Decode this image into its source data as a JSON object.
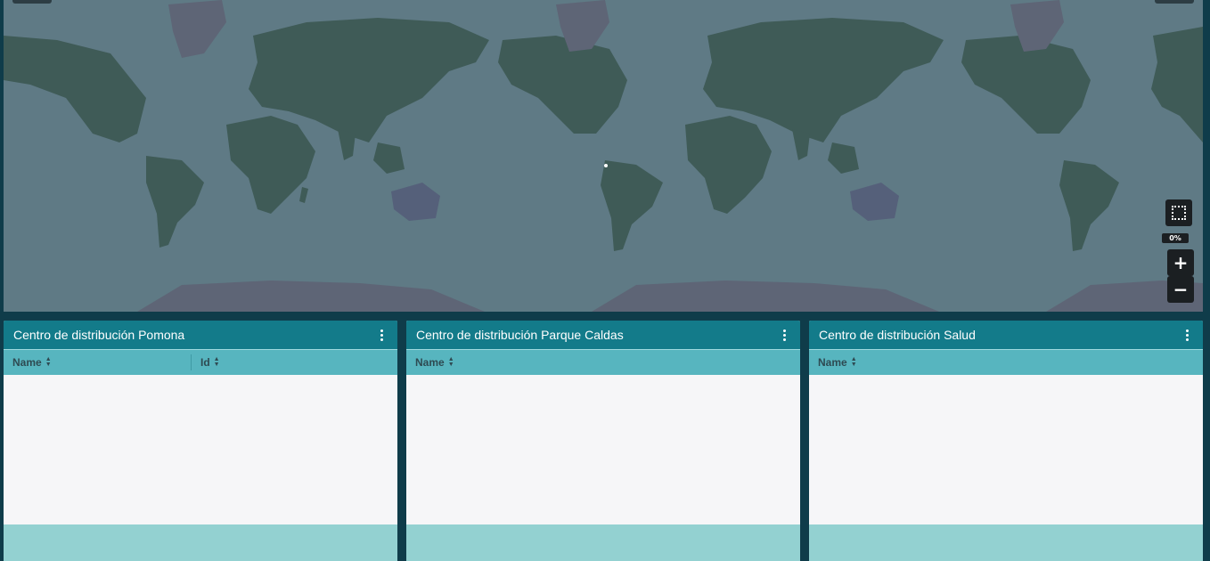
{
  "map": {
    "zoom_percent": "0%",
    "zoom_in_icon": "plus-icon",
    "zoom_out_icon": "minus-icon",
    "selection_icon": "dotted-square-icon",
    "colors": {
      "water": "#5f7a85",
      "land": "#3f5b57",
      "ice": "#5e6576"
    }
  },
  "widgets": [
    {
      "title": "Centro de distribución Pomona",
      "columns": [
        {
          "label": "Name"
        },
        {
          "label": "Id"
        }
      ]
    },
    {
      "title": "Centro de distribución Parque Caldas",
      "columns": [
        {
          "label": "Name"
        }
      ]
    },
    {
      "title": "Centro de distribución Salud",
      "columns": [
        {
          "label": "Name"
        }
      ]
    }
  ],
  "colors": {
    "header": "#137b8a",
    "column_header": "#57b5bf",
    "footer": "#93d1d1",
    "page_background": "#0f3c4a"
  }
}
